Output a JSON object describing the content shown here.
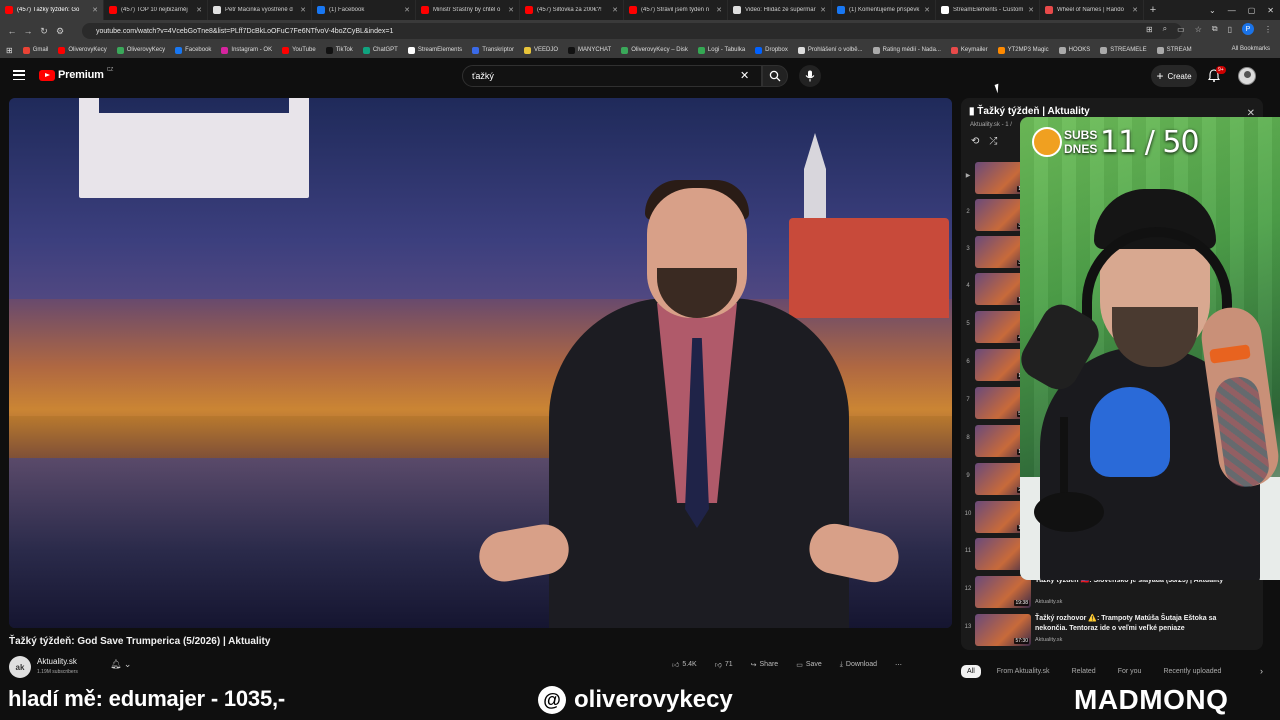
{
  "browser": {
    "tabs": [
      {
        "label": "(457) Ťažký týždeň: Go",
        "color": "#ff0000",
        "active": true
      },
      {
        "label": "(457) TOP 10 nejbizarněj",
        "color": "#ff0000"
      },
      {
        "label": "Petr Macinka vyostřeně d",
        "color": "#e0e0e0"
      },
      {
        "label": "(1) Facebook",
        "color": "#1877f2"
      },
      {
        "label": "Ministr Šťastný by chtěl o",
        "color": "#ff0000"
      },
      {
        "label": "(457) Šiltovka za 200€?! ",
        "color": "#ff0000"
      },
      {
        "label": "(457) Strávil jsem týden n",
        "color": "#ff0000"
      },
      {
        "label": "Video: Hlídač ze supermar",
        "color": "#dddddd"
      },
      {
        "label": "(1) Komentujeme příspěvk",
        "color": "#1877f2"
      },
      {
        "label": "StreamElements - Custom",
        "color": "#ffffff"
      },
      {
        "label": "Wheel of Names | Rando",
        "color": "#e84a4a"
      }
    ],
    "new_tab": "+",
    "url": "youtube.com/watch?v=4VcebGoTne8&list=PLff7DcBkLoOFuC7Fe6NTfvoV-4boZCyBL&index=1",
    "profile_initial": "P",
    "bookmarks": [
      {
        "label": "Gmail",
        "color": "#ea4335"
      },
      {
        "label": "OliverovyKecy",
        "color": "#ff0000"
      },
      {
        "label": "OliverovyKecy",
        "color": "#3aa85a"
      },
      {
        "label": "Facebook",
        "color": "#1877f2"
      },
      {
        "label": "Instagram - OK",
        "color": "#d6249f"
      },
      {
        "label": "YouTube",
        "color": "#ff0000"
      },
      {
        "label": "TikTok",
        "color": "#111111"
      },
      {
        "label": "ChatGPT",
        "color": "#10a37f"
      },
      {
        "label": "StreamElements",
        "color": "#ffffff"
      },
      {
        "label": "Transkriptor",
        "color": "#3a6ae8"
      },
      {
        "label": "VEEDJO",
        "color": "#e8c43a"
      },
      {
        "label": "MANYCHAT",
        "color": "#111111"
      },
      {
        "label": "OliverovyKecy – Disk",
        "color": "#3aa85a"
      },
      {
        "label": "Logi - Tabulka",
        "color": "#34a853"
      },
      {
        "label": "Dropbox",
        "color": "#0061ff"
      },
      {
        "label": "Prohlášení o volbě...",
        "color": "#dddddd"
      },
      {
        "label": "Rating médií - Nada...",
        "color": "#aaaaaa"
      },
      {
        "label": "Keymailer",
        "color": "#e84a4a"
      },
      {
        "label": "YT2MP3 Magic",
        "color": "#ff8a00"
      },
      {
        "label": "HOOKS",
        "color": "#aaaaaa"
      },
      {
        "label": "STREAMELE",
        "color": "#aaaaaa"
      },
      {
        "label": "STREAM",
        "color": "#aaaaaa"
      }
    ],
    "all_bookmarks": "All Bookmarks"
  },
  "youtube": {
    "logo_text": "Premium",
    "country": "CZ",
    "search_value": "ťažký",
    "create_label": "Create",
    "notif_badge": "9+"
  },
  "video": {
    "title": "Ťažký týždeň: God Save Trumperica (5/2026) | Aktuality",
    "channel": "Aktuality.sk",
    "channel_initials": "ak",
    "subs": "1.19M subscribers",
    "likes": "5.4K",
    "dislikes": "71",
    "share": "Share",
    "save": "Save",
    "download": "Download",
    "more": "⋯"
  },
  "playlist": {
    "title": "Ťažký týždeň | Aktuality",
    "sub": "Aktuality.sk - 1 / ",
    "items": [
      {
        "num": "▶",
        "dur": "13:3",
        "title": "",
        "channel": ""
      },
      {
        "num": "2",
        "dur": "30:0",
        "title": "",
        "channel": ""
      },
      {
        "num": "3",
        "dur": "35:1",
        "title": "",
        "channel": ""
      },
      {
        "num": "4",
        "dur": "14:2",
        "title": "",
        "channel": ""
      },
      {
        "num": "5",
        "dur": "46:5",
        "title": "",
        "channel": ""
      },
      {
        "num": "6",
        "dur": "12:5",
        "title": "",
        "channel": ""
      },
      {
        "num": "7",
        "dur": "57:1",
        "title": "",
        "channel": ""
      },
      {
        "num": "8",
        "dur": "14:2",
        "title": "",
        "channel": ""
      },
      {
        "num": "9",
        "dur": "22:2",
        "title": "",
        "channel": ""
      },
      {
        "num": "10",
        "dur": "17:2",
        "title": "",
        "channel": ""
      },
      {
        "num": "11",
        "dur": "9:1",
        "title": "",
        "channel": ""
      },
      {
        "num": "12",
        "dur": "19:38",
        "title": "Ťažký týždeň 🇸🇰: Slovensko je slayáda (38/25) | Aktuality",
        "channel": "Aktuality.sk"
      },
      {
        "num": "13",
        "dur": "57:30",
        "title": "Ťažký rozhovor ⚠️: Trampoty Matúša Šutaja Eštoka sa nekončia. Tentoraz ide o veľmi veľké peniaze",
        "channel": "Aktuality.sk"
      }
    ]
  },
  "chips": [
    "All",
    "From Aktuality.sk",
    "Related",
    "For you",
    "Recently uploaded"
  ],
  "stream_overlay": {
    "subs_label_1": "SUBS",
    "subs_label_2": "DNES",
    "subs_count": "11 / 50",
    "donation": "hladí mě: edumajer - 1035,-",
    "handle": "oliverovykecy",
    "brand": "MADMONQ"
  }
}
